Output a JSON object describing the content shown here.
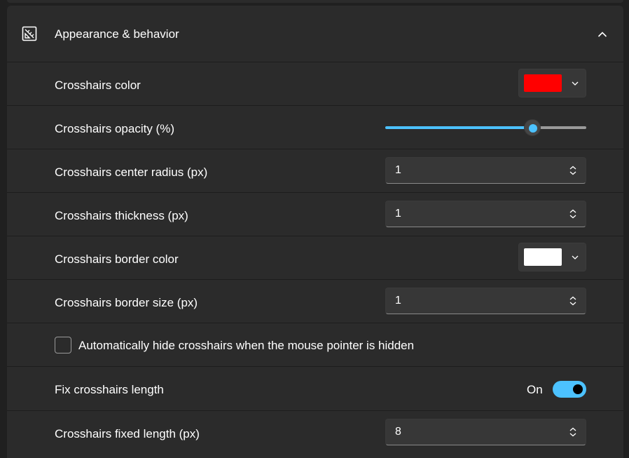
{
  "section": {
    "title": "Appearance & behavior",
    "icon": "ruler-icon",
    "collapse_icon": "chevron-up-icon"
  },
  "settings": {
    "crosshairs_color": {
      "label": "Crosshairs color",
      "value": "#ff0000"
    },
    "crosshairs_opacity": {
      "label": "Crosshairs opacity (%)",
      "value_fraction": 0.73
    },
    "center_radius": {
      "label": "Crosshairs center radius (px)",
      "value": "1"
    },
    "thickness": {
      "label": "Crosshairs thickness (px)",
      "value": "1"
    },
    "border_color": {
      "label": "Crosshairs border color",
      "value": "#ffffff"
    },
    "border_size": {
      "label": "Crosshairs border size (px)",
      "value": "1"
    },
    "auto_hide": {
      "label": "Automatically hide crosshairs when the mouse pointer is hidden",
      "checked": false
    },
    "fix_length": {
      "label": "Fix crosshairs length",
      "state": "On",
      "on": true
    },
    "fixed_length": {
      "label": "Crosshairs fixed length (px)",
      "value": "8"
    }
  },
  "colors": {
    "accent": "#4cc2ff",
    "panel": "#2b2b2b",
    "background": "#202020"
  }
}
